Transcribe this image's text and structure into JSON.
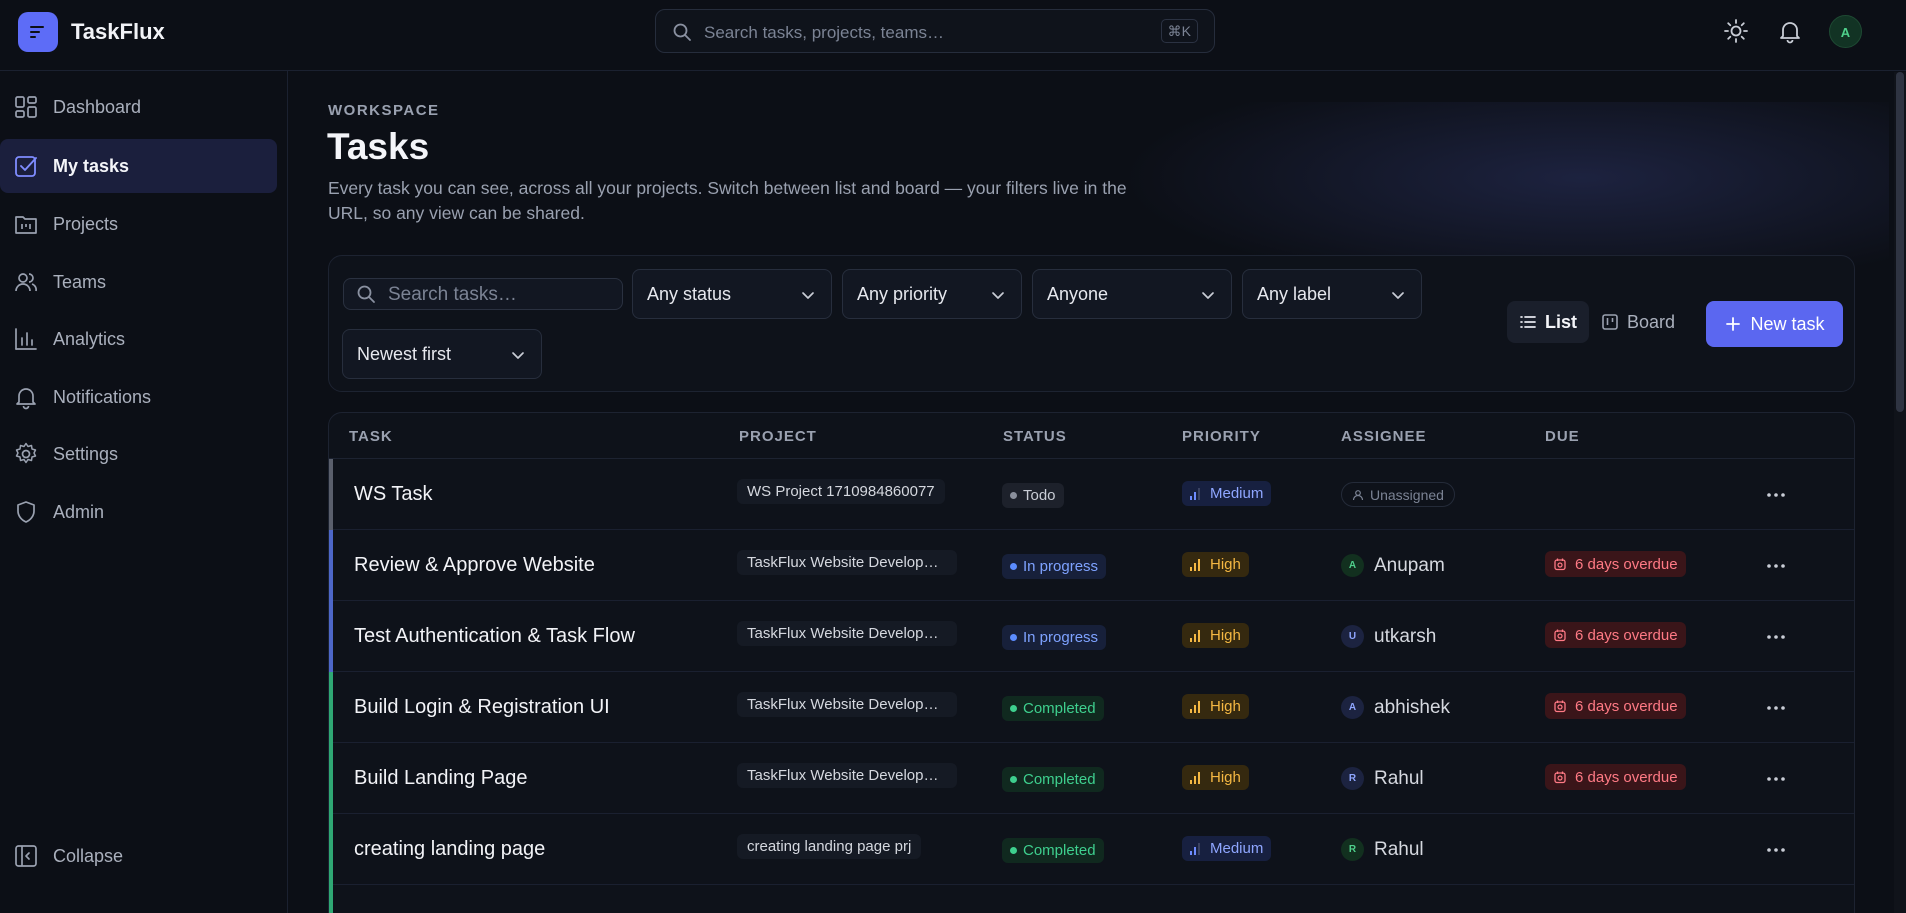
{
  "app": {
    "name": "TaskFlux",
    "search_placeholder": "Search tasks, projects, teams…",
    "search_shortcut": "⌘K",
    "avatar_initial": "A"
  },
  "sidebar": {
    "items": [
      {
        "label": "Dashboard",
        "icon": "grid-icon",
        "active": false
      },
      {
        "label": "My tasks",
        "icon": "check-square-icon",
        "active": true
      },
      {
        "label": "Projects",
        "icon": "folder-icon",
        "active": false
      },
      {
        "label": "Teams",
        "icon": "users-icon",
        "active": false
      },
      {
        "label": "Analytics",
        "icon": "bar-chart-icon",
        "active": false
      },
      {
        "label": "Notifications",
        "icon": "bell-icon",
        "active": false
      },
      {
        "label": "Settings",
        "icon": "gear-icon",
        "active": false
      },
      {
        "label": "Admin",
        "icon": "shield-icon",
        "active": false
      }
    ],
    "collapse_label": "Collapse"
  },
  "page": {
    "eyebrow": "WORKSPACE",
    "title": "Tasks",
    "description": "Every task you can see, across all your projects. Switch between list and board — your filters live in the URL, so any view can be shared."
  },
  "filters": {
    "search_placeholder": "Search tasks…",
    "status": "Any status",
    "priority": "Any priority",
    "assignee": "Anyone",
    "label": "Any label",
    "sort": "Newest first",
    "view_list": "List",
    "view_board": "Board",
    "new_task": "New task"
  },
  "table": {
    "headers": [
      "TASK",
      "PROJECT",
      "STATUS",
      "PRIORITY",
      "ASSIGNEE",
      "DUE"
    ],
    "rows": [
      {
        "task": "WS Task",
        "project": "WS Project 1710984860077",
        "status": "Todo",
        "priority": "Medium",
        "assignee": "Unassigned",
        "assignee_initial": "",
        "due": ""
      },
      {
        "task": "Review & Approve Website",
        "project": "TaskFlux Website Development",
        "status": "In progress",
        "priority": "High",
        "assignee": "Anupam",
        "assignee_initial": "A",
        "due": "6 days overdue"
      },
      {
        "task": "Test Authentication & Task Flow",
        "project": "TaskFlux Website Development",
        "status": "In progress",
        "priority": "High",
        "assignee": "utkarsh",
        "assignee_initial": "U",
        "due": "6 days overdue"
      },
      {
        "task": "Build Login & Registration UI",
        "project": "TaskFlux Website Development",
        "status": "Completed",
        "priority": "High",
        "assignee": "abhishek",
        "assignee_initial": "A",
        "due": "6 days overdue"
      },
      {
        "task": "Build Landing Page",
        "project": "TaskFlux Website Development",
        "status": "Completed",
        "priority": "High",
        "assignee": "Rahul",
        "assignee_initial": "R",
        "due": "6 days overdue"
      },
      {
        "task": "creating landing page",
        "project": "creating landing page prj",
        "status": "Completed",
        "priority": "Medium",
        "assignee": "Rahul",
        "assignee_initial": "R",
        "due": ""
      }
    ]
  },
  "colors": {
    "accent": "#5b67f0",
    "todo": "#8a8f9c",
    "in_progress": "#5b8cff",
    "completed": "#3ecf8e",
    "high": "#f5b843",
    "medium": "#6e8cff",
    "overdue": "#ff7a85"
  }
}
